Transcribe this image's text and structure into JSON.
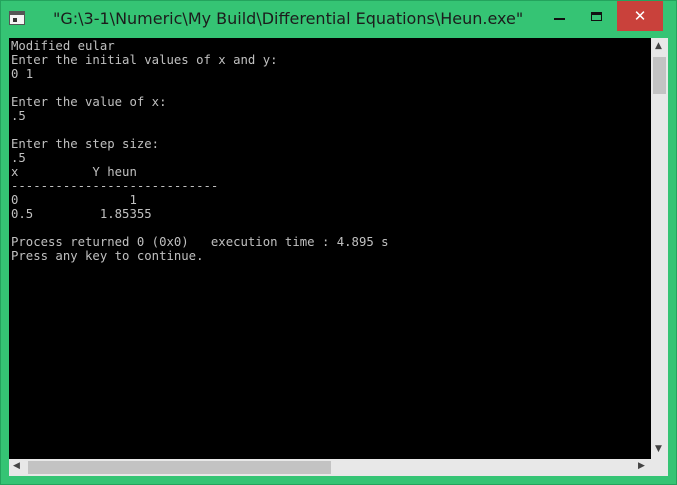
{
  "window": {
    "title": "\"G:\\3-1\\Numeric\\My Build\\Differential Equations\\Heun.exe\"",
    "icon": "console-app-icon",
    "controls": {
      "minimize": "—",
      "maximize": "☐",
      "close": "✕"
    }
  },
  "console": {
    "lines": [
      "Modified eular",
      "Enter the initial values of x and y:",
      "0 1",
      "",
      "Enter the value of x:",
      ".5",
      "",
      "Enter the step size:",
      ".5",
      "x          Y heun",
      "----------------------------",
      "0               1",
      "0.5         1.85355",
      "",
      "Process returned 0 (0x0)   execution time : 4.895 s",
      "Press any key to continue."
    ]
  },
  "scrollbars": {
    "up": "▲",
    "down": "▼",
    "left": "◀",
    "right": "▶"
  },
  "colors": {
    "titlebar": "#35c474",
    "close": "#c9413b",
    "console_bg": "#000000",
    "console_fg": "#c0c0c0"
  }
}
